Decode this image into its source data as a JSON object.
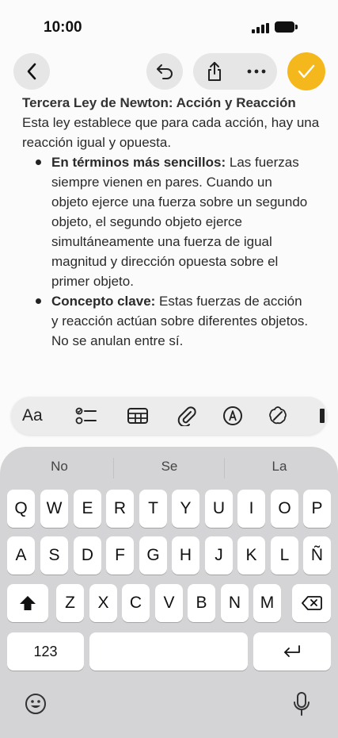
{
  "status_bar": {
    "time": "10:00"
  },
  "nav": {
    "back_icon": "chevron-left-icon",
    "undo_icon": "undo-icon",
    "share_icon": "share-icon",
    "more_icon": "ellipsis-icon",
    "done_icon": "checkmark-icon"
  },
  "note": {
    "title": "Tercera Ley de Newton: Acción y Reacción",
    "intro": "Esta ley establece que para cada acción, hay una reacción igual y opuesta.",
    "bullets": [
      {
        "bold": "En términos más sencillos:",
        "text": " Las fuerzas siempre vienen en pares. Cuando un objeto ejerce una fuerza sobre un segundo objeto, el segundo objeto ejerce simultáneamente una fuerza de igual magnitud y dirección opuesta sobre el primer objeto."
      },
      {
        "bold": "Concepto clave:",
        "text": " Estas fuerzas de acción y reacción actúan sobre diferentes objetos. No se anulan entre sí."
      }
    ]
  },
  "format_toolbar": {
    "text_style_label": "Aa",
    "tools": [
      "checklist-icon",
      "table-icon",
      "attachment-icon",
      "markup-icon",
      "writing-tools-icon"
    ]
  },
  "keyboard": {
    "suggestions": [
      "No",
      "Se",
      "La"
    ],
    "row1": [
      "Q",
      "W",
      "E",
      "R",
      "T",
      "Y",
      "U",
      "I",
      "O",
      "P"
    ],
    "row2": [
      "A",
      "S",
      "D",
      "F",
      "G",
      "H",
      "J",
      "K",
      "L",
      "Ñ"
    ],
    "row3": [
      "Z",
      "X",
      "C",
      "V",
      "B",
      "N",
      "M"
    ],
    "numbers_label": "123"
  }
}
